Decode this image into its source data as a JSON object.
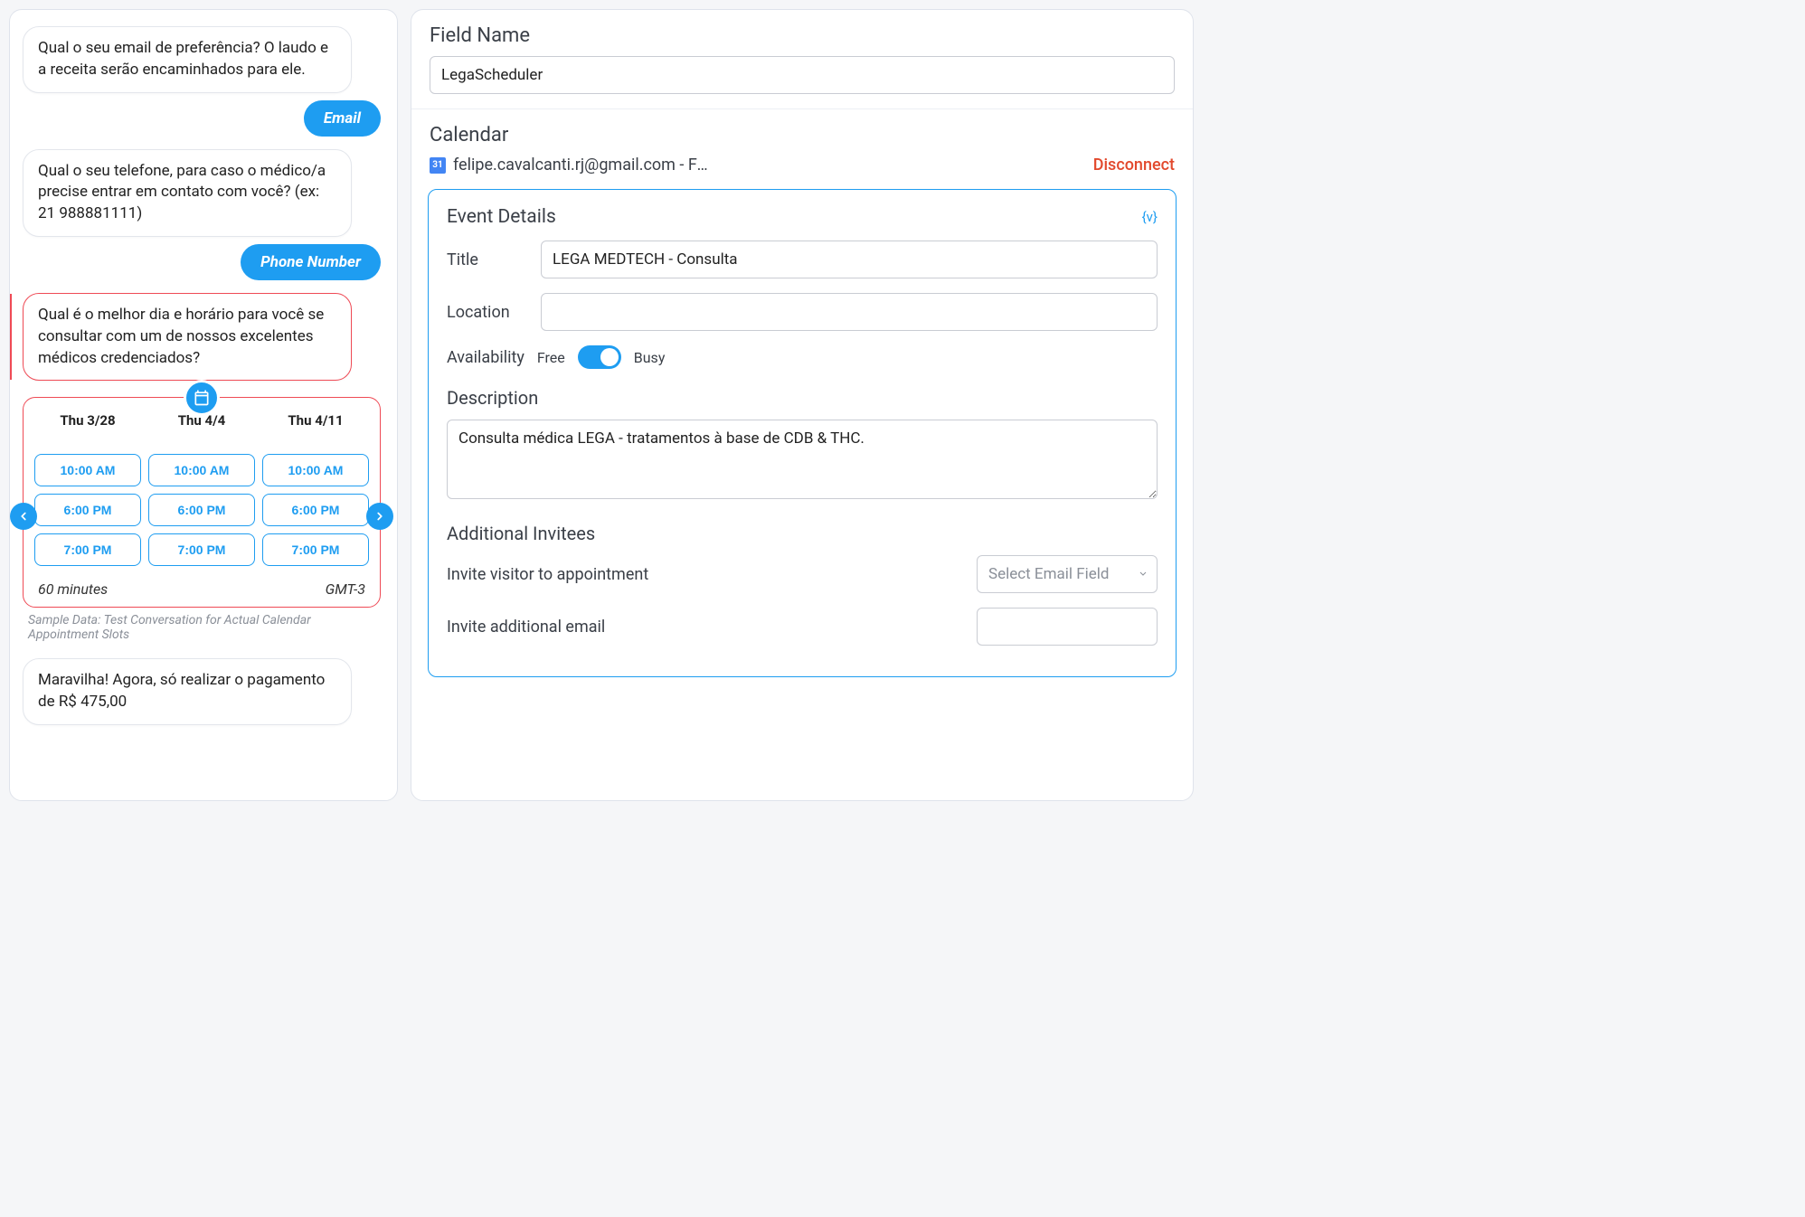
{
  "chat": {
    "msg_email_q": "Qual o seu email de preferência? O laudo e a receita serão encaminhados para ele.",
    "pill_email": "Email",
    "msg_phone_q": "Qual o seu telefone, para caso o médico/a precise entrar em contato com você? (ex: 21 988881111)",
    "pill_phone": "Phone Number",
    "msg_schedule_q": "Qual é o melhor dia e horário para você se consultar com um de nossos excelentes médicos credenciados?",
    "calendar": {
      "columns": [
        {
          "header": "Thu 3/28",
          "slots": [
            "10:00 AM",
            "6:00 PM",
            "7:00 PM"
          ]
        },
        {
          "header": "Thu 4/4",
          "slots": [
            "10:00 AM",
            "6:00 PM",
            "7:00 PM"
          ]
        },
        {
          "header": "Thu 4/11",
          "slots": [
            "10:00 AM",
            "6:00 PM",
            "7:00 PM"
          ]
        }
      ],
      "duration": "60 minutes",
      "timezone": "GMT-3"
    },
    "sample_note": "Sample Data: Test Conversation for Actual Calendar Appointment Slots",
    "msg_payment": "Maravilha! Agora, só realizar o pagamento de R$ 475,00"
  },
  "config": {
    "field_name_label": "Field Name",
    "field_name_value": "LegaScheduler",
    "calendar_label": "Calendar",
    "calendar_account": "felipe.cavalcanti.rj@gmail.com - Felipe Caval…",
    "gcal_day": "31",
    "disconnect": "Disconnect",
    "event": {
      "header": "Event Details",
      "var_badge": "{v}",
      "title_label": "Title",
      "title_value": "LEGA MEDTECH - Consulta",
      "location_label": "Location",
      "location_value": "",
      "availability_label": "Availability",
      "avail_free": "Free",
      "avail_busy": "Busy",
      "description_label": "Description",
      "description_value": "Consulta médica LEGA - tratamentos à base de CDB & THC.",
      "invitees_header": "Additional Invitees",
      "invite_visitor_label": "Invite visitor to appointment",
      "invite_visitor_placeholder": "Select Email Field",
      "invite_additional_label": "Invite additional email"
    }
  }
}
